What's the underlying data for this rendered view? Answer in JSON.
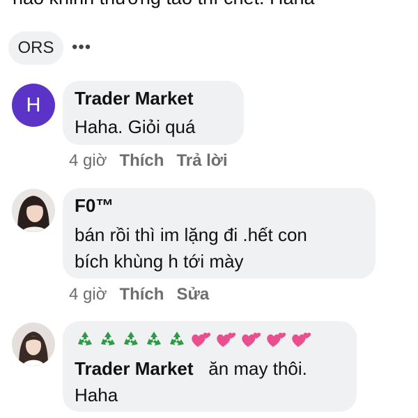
{
  "previous_comment": {
    "cut_text": "nào khinh thường tao thì chết. Haha"
  },
  "reply_chip": {
    "label": "ORS",
    "more": "•••"
  },
  "comments": [
    {
      "avatar_letter": "H",
      "avatar_color": "#5b33c7",
      "author": "Trader Market",
      "lines": [
        "Haha. Giỏi quá"
      ],
      "time": "4 giờ",
      "like": "Thích",
      "action": "Trả lời"
    },
    {
      "avatar_icon": "profile-photo-woman",
      "author": "F0™",
      "lines": [
        "bán rồi thì im  lặng đi .hết con",
        "bích khùng h tới mày"
      ],
      "time": "4 giờ",
      "like": "Thích",
      "action": "Sửa"
    },
    {
      "avatar_icon": "profile-photo-woman",
      "emoji": [
        "recycle-icon",
        "recycle-icon",
        "recycle-icon",
        "recycle-icon",
        "recycle-icon",
        "two-hearts-icon",
        "two-hearts-icon",
        "two-hearts-icon",
        "two-hearts-icon",
        "two-hearts-icon"
      ],
      "mention": "Trader Market",
      "text_after_mention": "ăn may thôi.",
      "line2": "Haha"
    }
  ]
}
